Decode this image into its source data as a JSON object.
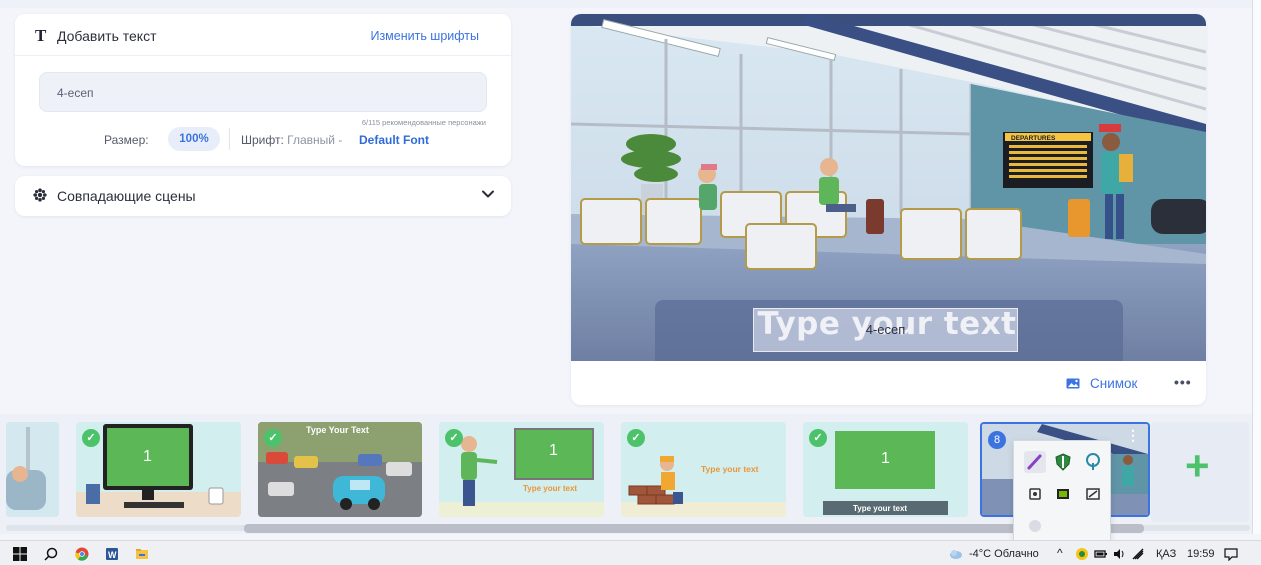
{
  "add_text": {
    "title": "Добавить текст",
    "change_fonts": "Изменить шрифты",
    "input_value": "4-есеп",
    "counter": "6/115 рекомендованные персонажи",
    "size_label": "Размер:",
    "size_value": "100%",
    "font_label": "Шрифт:",
    "font_sub": "Главный -",
    "font_value": "Default Font"
  },
  "matching_scenes": {
    "title": "Совпадающие сцены"
  },
  "preview": {
    "caption_placeholder": "Type your text",
    "caption_text": "4-есеп",
    "departures_label": "DEPARTURES",
    "snapshot_label": "Снимок",
    "more_label": "•••"
  },
  "timeline": {
    "scenes": [
      {
        "id": "partial",
        "checked": false
      },
      {
        "id": "computer",
        "checked": true,
        "label": "1"
      },
      {
        "id": "parking",
        "checked": true,
        "label": "Type Your Text"
      },
      {
        "id": "presenter",
        "checked": true,
        "label": "1",
        "sub": "Type your text"
      },
      {
        "id": "worker",
        "checked": true,
        "label": "Type your text"
      },
      {
        "id": "slide",
        "checked": true,
        "label": "1",
        "sub": "Type your text"
      },
      {
        "id": "airport",
        "checked": false,
        "badge": "8"
      }
    ],
    "add_label": "+"
  },
  "taskbar": {
    "weather": "-4°C Облачно",
    "lang": "ҚАЗ",
    "time": "19:59"
  },
  "colors": {
    "accent": "#3b73e0",
    "green": "#4cc36a"
  }
}
